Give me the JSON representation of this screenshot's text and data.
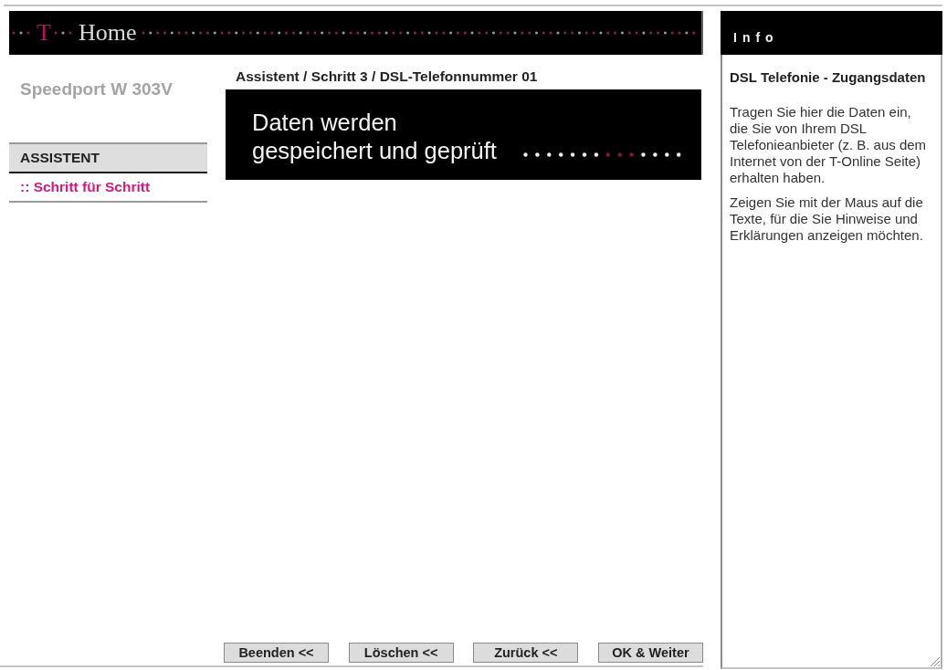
{
  "header": {
    "logo_letter": "T",
    "brand": "Home"
  },
  "sidebar": {
    "device": "Speedport W 303V",
    "section": "ASSISTENT",
    "items": [
      {
        "label": ":: Schritt für Schritt",
        "selected": true
      }
    ]
  },
  "main": {
    "breadcrumb": "Assistent / Schritt 3 / DSL-Telefonnummer 01",
    "status_lines": [
      "Daten werden",
      "gespeichert und geprüft"
    ]
  },
  "buttons": [
    {
      "label": "Beenden <<"
    },
    {
      "label": "Löschen <<"
    },
    {
      "label": "Zurück <<"
    },
    {
      "label": "OK & Weiter"
    }
  ],
  "info": {
    "title": "Info",
    "heading": "DSL Telefonie - Zugangsdaten",
    "paragraphs": [
      "Tragen Sie hier die Daten ein, die Sie von Ihrem DSL Telefonieanbieter (z. B. aus dem Internet von der T-Online Seite) erhalten haben.",
      "Zeigen Sie mit der Maus auf die Texte, für die Sie Hinweise und Erklärungen anzeigen möchten."
    ]
  }
}
